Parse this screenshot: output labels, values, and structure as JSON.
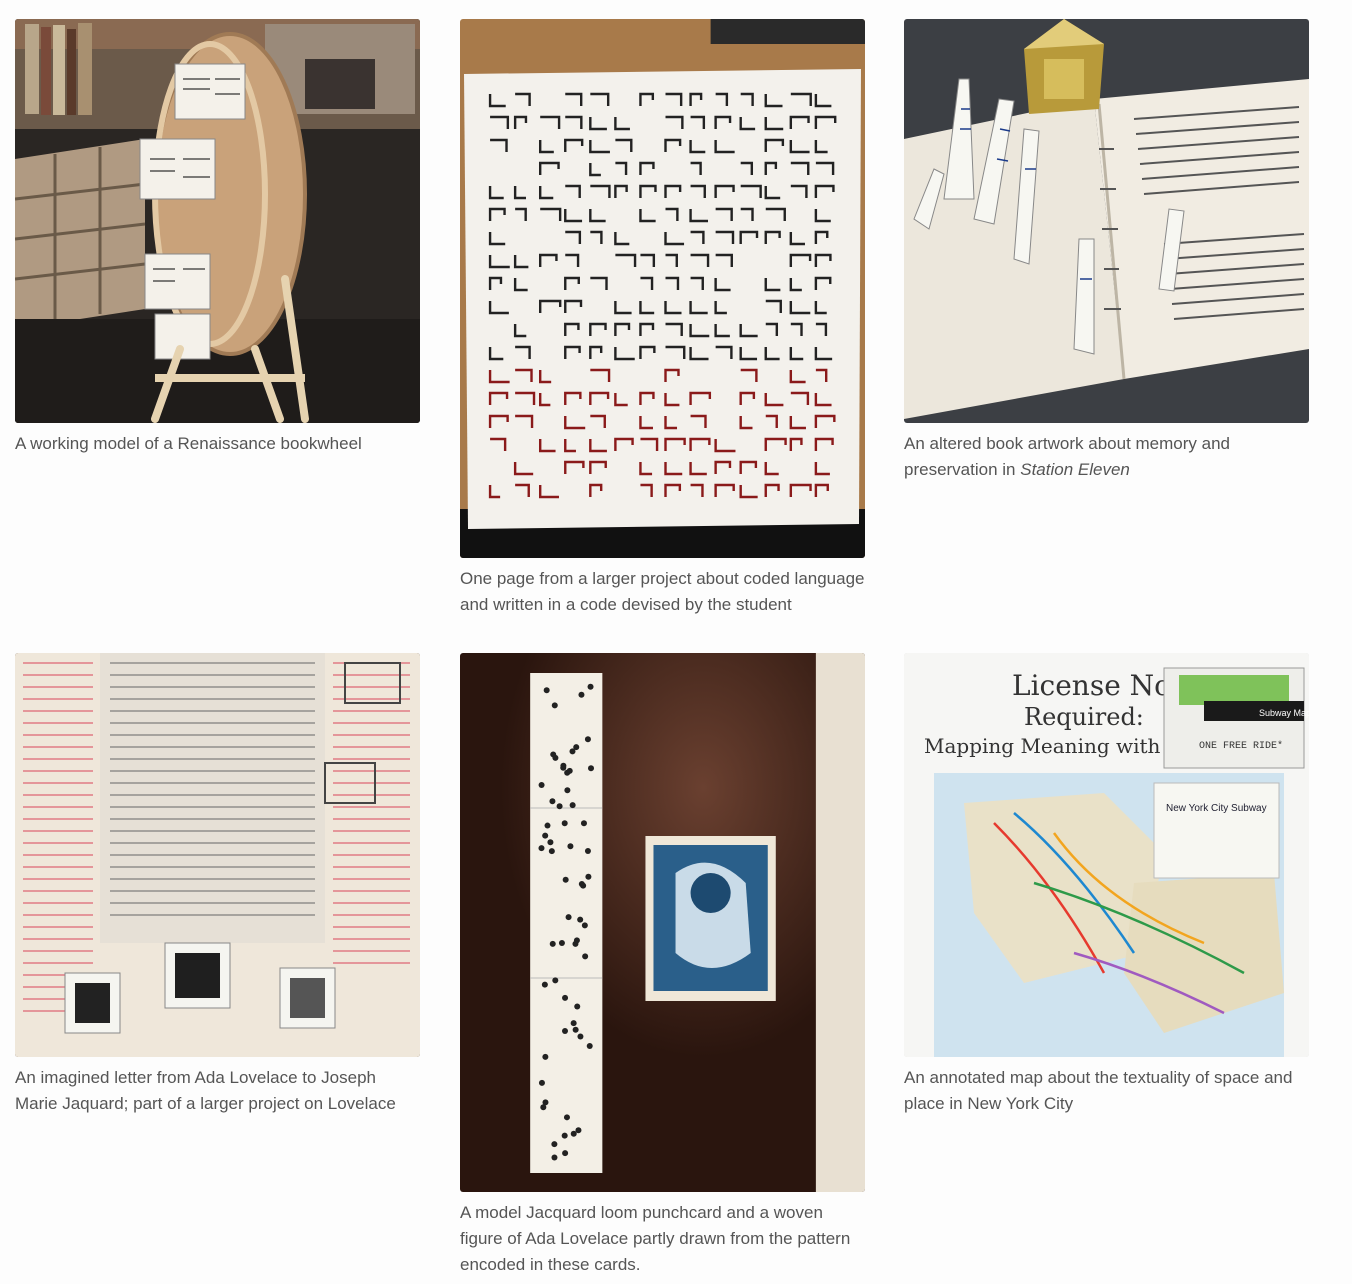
{
  "gallery": {
    "items": [
      {
        "id": "bookwheel",
        "caption": "A working model of a Renaissance bookwheel",
        "image_alt": "Wooden bookwheel model with small folded booklets on shelves"
      },
      {
        "id": "coded-language",
        "caption": "One page from a larger project about coded language and written in a code devised by the student",
        "image_alt": "Paper covered in hand-drawn angular code glyphs in black and red ink"
      },
      {
        "id": "altered-book",
        "caption_prefix": "An altered book artwork about memory and preservation in ",
        "caption_title": "Station Eleven",
        "image_alt": "Open book with paper hand sculptures and a gold foil house"
      },
      {
        "id": "lovelace-letter",
        "caption": "An imagined letter from Ada Lovelace to Joseph Marie Jaquard; part of a larger project on Lovelace",
        "image_alt": "Handwritten letter with red annotations and three printed portraits"
      },
      {
        "id": "jacquard-punchcard",
        "caption": "A model Jacquard loom punchcard and a woven figure of Ada Lovelace partly drawn from the pattern encoded in these cards.",
        "image_alt": "Paper punchcard strip beside a small blue woven portrait on a dark table"
      },
      {
        "id": "mta-map",
        "caption": "An annotated map about the textuality of space and place in New York City",
        "image_alt": "Annotated New York City subway map on a poster board",
        "poster_title_line1": "License Not",
        "poster_title_line2": "Required:",
        "poster_subtitle": "Mapping Meaning with the MTA",
        "ticket_text": "ONE FREE RIDE*",
        "map_header": "New York City Subway",
        "card_label": "Subway Map"
      }
    ]
  },
  "colors": {
    "caption_text": "#555555",
    "page_background": "#fdfdfd"
  }
}
